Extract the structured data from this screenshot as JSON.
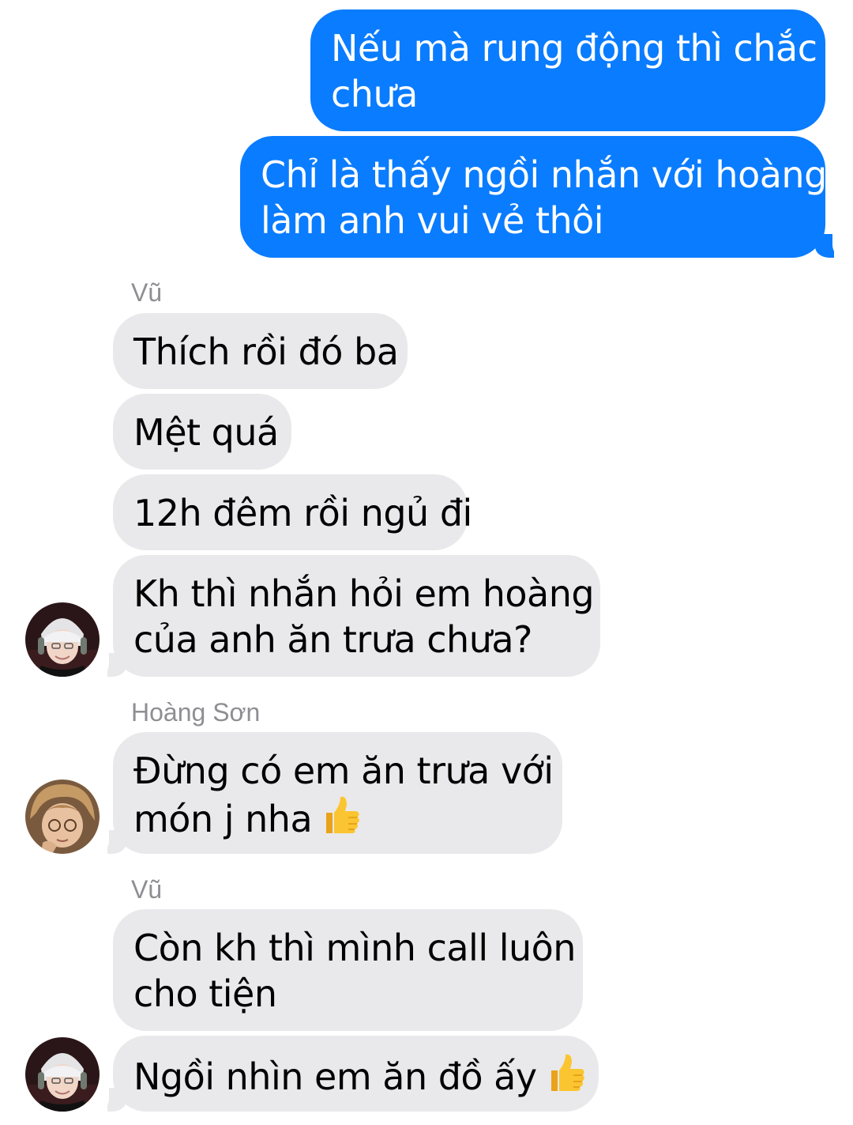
{
  "conversation": {
    "outgoing": [
      {
        "lines": [
          "Nếu mà rung động thì chắc",
          "chưa"
        ]
      },
      {
        "lines": [
          "Chỉ là thấy ngồi nhắn với hoàng",
          "làm anh vui vẻ thôi"
        ]
      }
    ],
    "senders": {
      "vu_1": "Vũ",
      "hoang_son": "Hoàng Sơn",
      "vu_2": "Vũ"
    },
    "incoming": [
      {
        "lines": [
          "Thích rồi đó ba"
        ]
      },
      {
        "lines": [
          "Mệt quá"
        ]
      },
      {
        "lines": [
          "12h đêm rồi ngủ đi"
        ]
      },
      {
        "lines": [
          "Kh thì nhắn hỏi em hoàng",
          "của anh ăn trưa chưa?"
        ]
      },
      {
        "lines": [
          "Đừng có em ăn trưa với",
          "món j nha"
        ],
        "emoji": "thumbs-up"
      },
      {
        "lines": [
          "Còn kh thì mình call luôn",
          "cho tiện"
        ]
      },
      {
        "lines": [
          "Ngồi nhìn em ăn đồ ấy"
        ],
        "emoji": "thumbs-up"
      }
    ]
  },
  "colors": {
    "outgoing_bubble": "#0a7cff",
    "incoming_bubble": "#e9e9eb",
    "sender_name": "#8e8e93",
    "background": "#ffffff"
  },
  "icons": {
    "avatar_vu": "avatar-vu",
    "avatar_hoang_son": "avatar-hoang-son",
    "emoji": "thumbs-up-emoji"
  }
}
